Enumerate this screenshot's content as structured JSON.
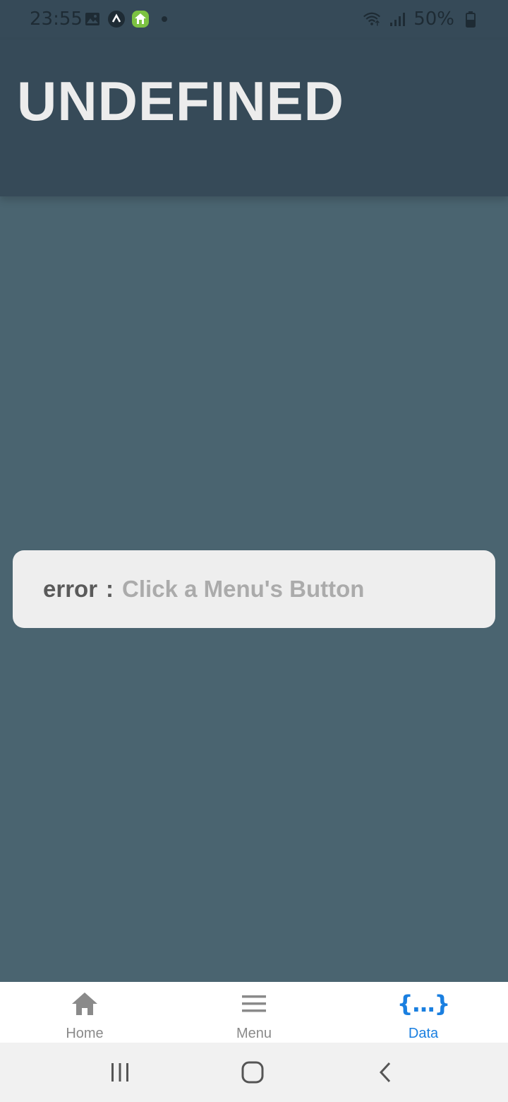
{
  "status_bar": {
    "time": "23:55",
    "left_icons": [
      "gallery-icon",
      "app-a-icon",
      "green-home-app-icon",
      "notification-dot-icon"
    ],
    "right_icons": [
      "wifi-icon",
      "signal-icon",
      "battery-icon"
    ],
    "battery": "50%"
  },
  "header": {
    "title": "UNDEFINED",
    "background": "#364a58"
  },
  "error_card": {
    "key": "error",
    "separator": ":",
    "message": "Click a Menu's Button"
  },
  "tab_bar": {
    "tabs": [
      {
        "label": "Home",
        "icon": "home-icon",
        "active": false
      },
      {
        "label": "Menu",
        "icon": "menu-icon",
        "active": false
      },
      {
        "label": "Data",
        "icon": "data-braces-icon",
        "active": true
      }
    ],
    "active_color": "#1a7fe0",
    "inactive_color": "#8a8a8a"
  },
  "system_nav": {
    "buttons": [
      "recent-apps-icon",
      "home-nav-icon",
      "back-icon"
    ]
  },
  "colors": {
    "page_background": "#4a6470",
    "card_background": "#eeeeee"
  }
}
